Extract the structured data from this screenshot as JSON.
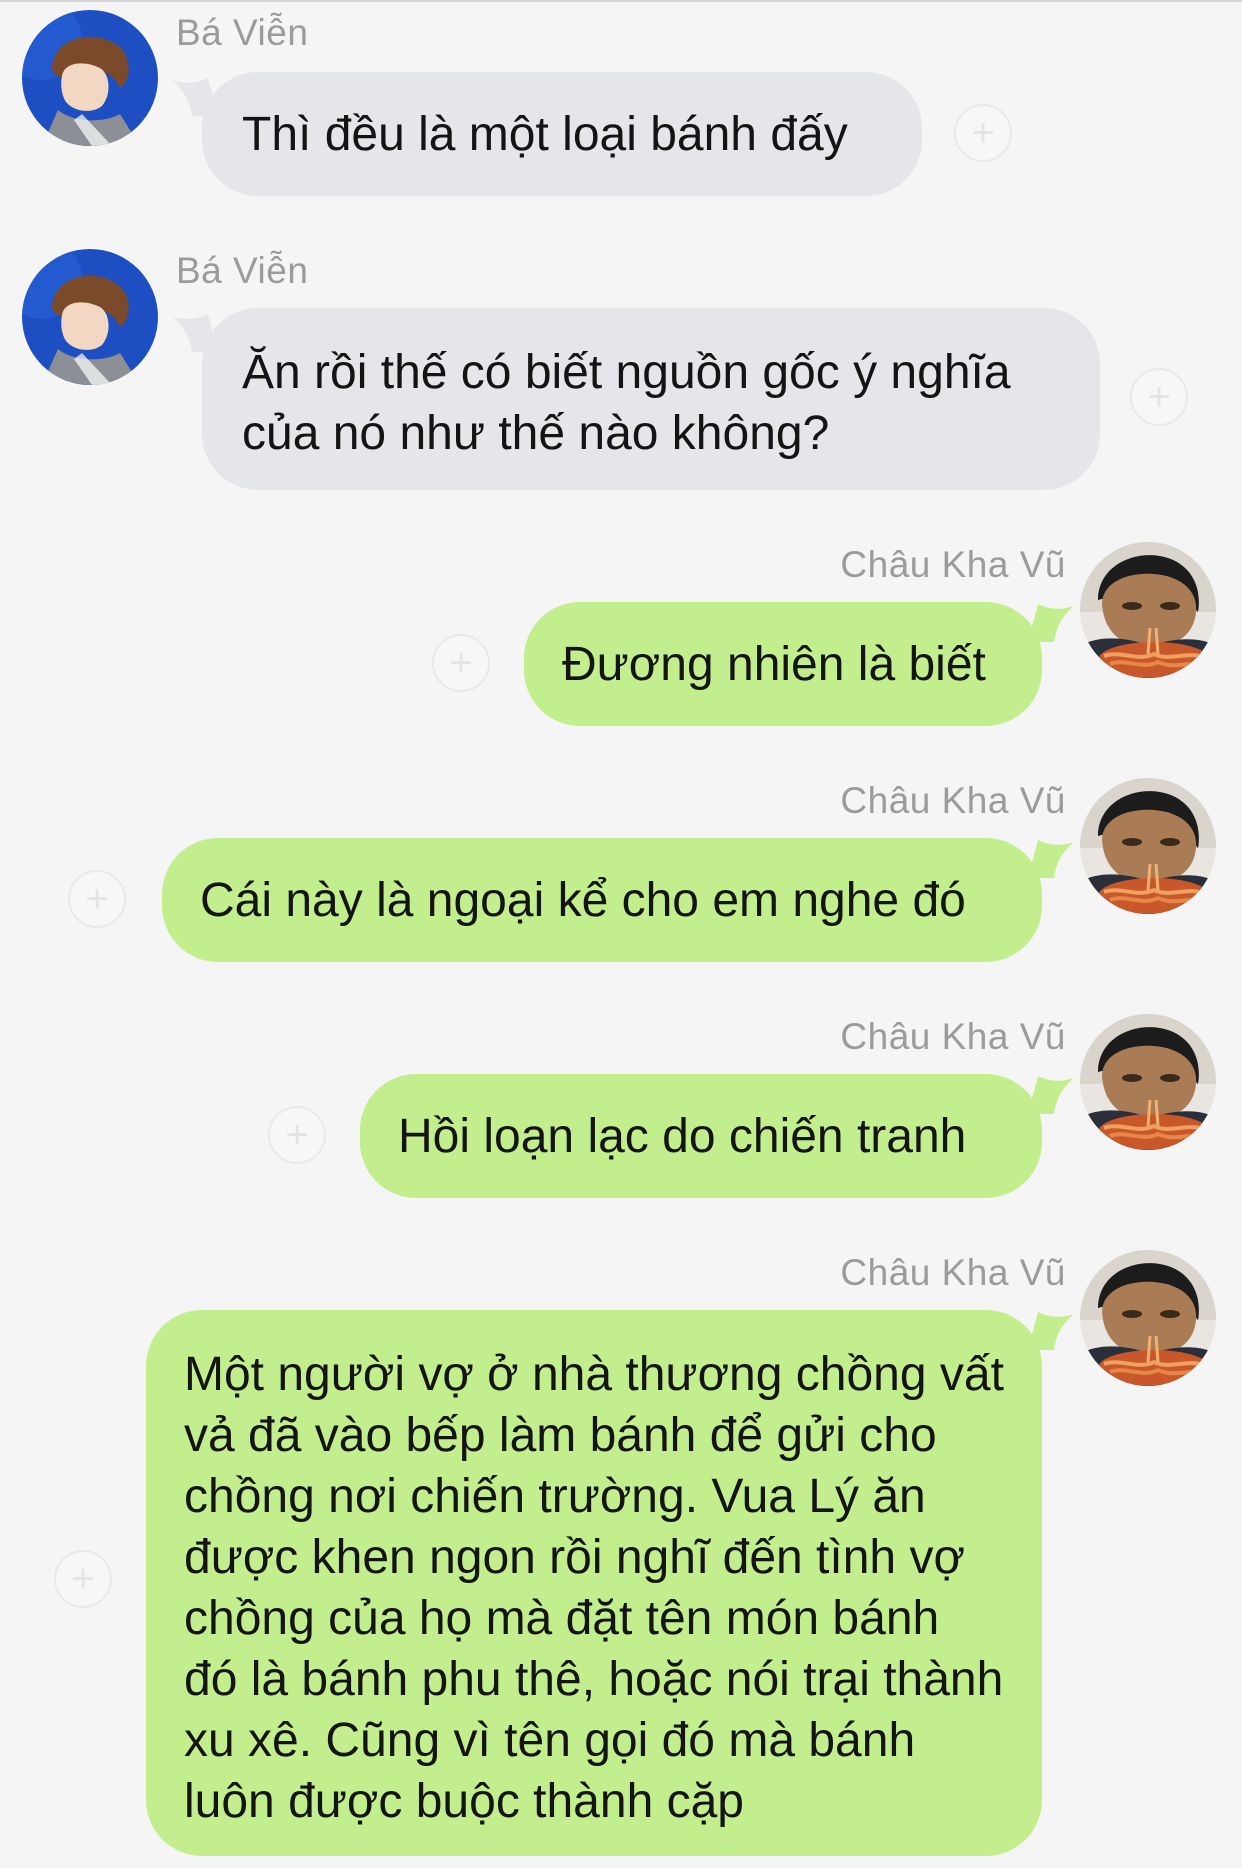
{
  "colors": {
    "incoming_bubble": "#e4e6ea",
    "outgoing_bubble": "#c2ee8d",
    "sender_name": "#9b9b9b",
    "text": "#141414"
  },
  "messages": [
    {
      "sender": "Bá Viễn",
      "direction": "incoming",
      "avatar_icon": "boy-profile-blue-background-avatar",
      "text": "Thì đều là một loại bánh đấy"
    },
    {
      "sender": "Bá Viễn",
      "direction": "incoming",
      "avatar_icon": "boy-profile-blue-background-avatar",
      "text": "Ăn rồi thế có biết nguồn gốc ý nghĩa của nó như thế nào không?"
    },
    {
      "sender": "Châu Kha Vũ",
      "direction": "outgoing",
      "avatar_icon": "kid-eating-noodles-avatar",
      "text": "Đương nhiên là biết"
    },
    {
      "sender": "Châu Kha Vũ",
      "direction": "outgoing",
      "avatar_icon": "kid-eating-noodles-avatar",
      "text": "Cái này là ngoại kể cho em nghe đó"
    },
    {
      "sender": "Châu Kha Vũ",
      "direction": "outgoing",
      "avatar_icon": "kid-eating-noodles-avatar",
      "text": "Hồi loạn lạc do chiến tranh"
    },
    {
      "sender": "Châu Kha Vũ",
      "direction": "outgoing",
      "avatar_icon": "kid-eating-noodles-avatar",
      "text": "Một người vợ ở nhà thương chồng vất vả đã vào bếp làm bánh để gửi cho chồng nơi chiến trường. Vua Lý ăn được khen ngon rồi nghĩ đến tình vợ chồng của họ mà đặt tên món bánh đó là bánh phu thê, hoặc nói trại thành xu xê. Cũng vì tên gọi đó mà bánh luôn được buộc thành cặp"
    }
  ],
  "reaction_icon": "add-reaction-icon",
  "reaction_glyph": "+"
}
